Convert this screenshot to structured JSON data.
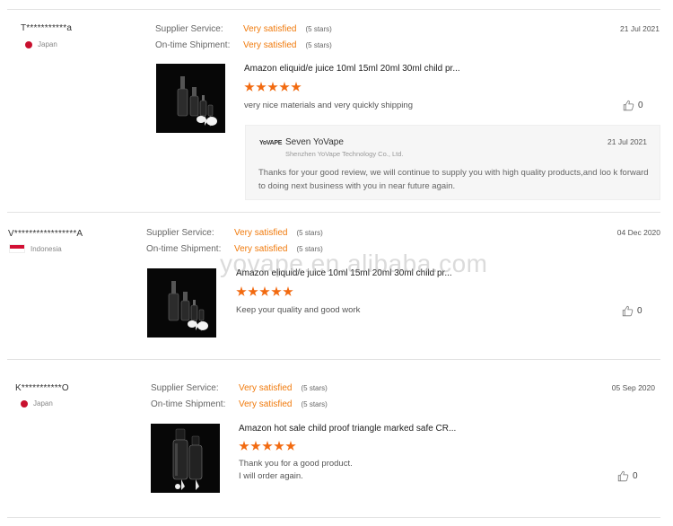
{
  "watermark": "yovape.en.alibaba.com",
  "reviews": [
    {
      "buyer": "T***********a",
      "country": "Japan",
      "supplier_label": "Supplier Service:",
      "supplier_value": "Very satisfied",
      "supplier_stars": "(5 stars)",
      "shipment_label": "On-time Shipment:",
      "shipment_value": "Very satisfied",
      "shipment_stars": "(5 stars)",
      "date": "21 Jul 2021",
      "product_title": "Amazon eliquid/e juice 10ml 15ml 20ml 30ml child pr...",
      "rating": 5,
      "comment": "very nice materials and very quickly shipping",
      "likes": "0",
      "reply": {
        "logo": "YoVAPE",
        "name": "Seven YoVape",
        "company": "Shenzhen YoVape Technology Co., Ltd.",
        "date": "21 Jul 2021",
        "text": "Thanks for your good review, we will continue to supply you with high quality products,and loo k forward to doing next business with you in near future again."
      }
    },
    {
      "buyer": "V*****************A",
      "country": "Indonesia",
      "supplier_label": "Supplier Service:",
      "supplier_value": "Very satisfied",
      "supplier_stars": "(5 stars)",
      "shipment_label": "On-time Shipment:",
      "shipment_value": "Very satisfied",
      "shipment_stars": "(5 stars)",
      "date": "04 Dec 2020",
      "product_title": "Amazon eliquid/e juice 10ml 15ml 20ml 30ml child pr...",
      "rating": 5,
      "comment": "Keep your quality and good work",
      "likes": "0"
    },
    {
      "buyer": "K***********O",
      "country": "Japan",
      "supplier_label": "Supplier Service:",
      "supplier_value": "Very satisfied",
      "supplier_stars": "(5 stars)",
      "shipment_label": "On-time Shipment:",
      "shipment_value": "Very satisfied",
      "shipment_stars": "(5 stars)",
      "date": "05 Sep 2020",
      "product_title": "Amazon hot sale child proof triangle marked safe CR...",
      "rating": 5,
      "comment_line1": "Thank you for a good product.",
      "comment_line2": "I will order again.",
      "likes": "0"
    }
  ]
}
